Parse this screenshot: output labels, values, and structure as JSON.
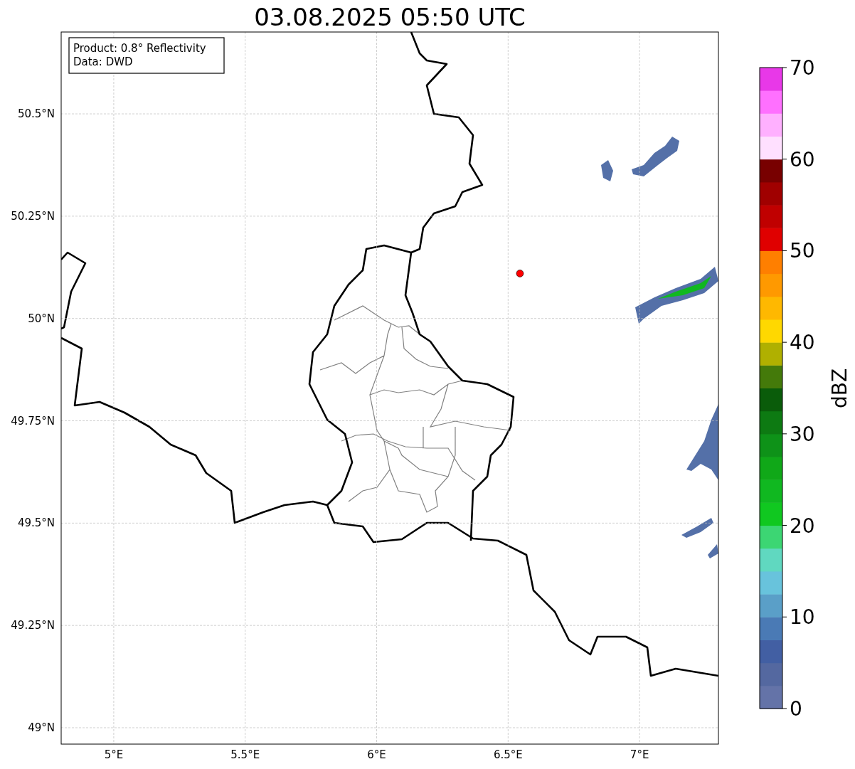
{
  "title": "03.08.2025 05:50 UTC",
  "legend": [
    "Product: 0.8° Reflectivity",
    "Data: DWD"
  ],
  "map": {
    "chart_data": {
      "type": "scatter",
      "x": [
        6.545
      ],
      "series": [
        {
          "color": "#ff0000",
          "values": [
            50.11
          ]
        }
      ],
      "xlim": [
        4.8,
        7.3
      ],
      "grid": true,
      "ylim": [
        48.96,
        50.7
      ],
      "xticks": [
        {
          "value": 5,
          "label": "5°E"
        },
        {
          "value": 5.5,
          "label": "5.5°E"
        },
        {
          "value": 6,
          "label": "6°E"
        },
        {
          "value": 6.5,
          "label": "6.5°E"
        },
        {
          "value": 7,
          "label": "7°E"
        }
      ],
      "yticks": [
        {
          "value": 49,
          "label": "49°N"
        },
        {
          "value": 49.25,
          "label": "49.25°N"
        },
        {
          "value": 49.5,
          "label": "49.5°N"
        },
        {
          "value": 49.75,
          "label": "49.75°N"
        },
        {
          "value": 50,
          "label": "50°N"
        },
        {
          "value": 50.25,
          "label": "50.25°N"
        },
        {
          "value": 50.5,
          "label": "50.5°N"
        }
      ]
    }
  },
  "colorbar": {
    "label": "dBZ",
    "ticks": [
      "70",
      "60",
      "50",
      "40",
      "30",
      "20",
      "10",
      "0"
    ],
    "bins": [
      {
        "color": "#6473a8"
      },
      {
        "color": "#5468a0"
      },
      {
        "color": "#425fa3"
      },
      {
        "color": "#4a7ab5"
      },
      {
        "color": "#5a9fc8"
      },
      {
        "color": "#68c3dc"
      },
      {
        "color": "#60d8c0"
      },
      {
        "color": "#3cd673"
      },
      {
        "color": "#10c820"
      },
      {
        "color": "#10b820"
      },
      {
        "color": "#10a818"
      },
      {
        "color": "#0e9218"
      },
      {
        "color": "#0d7a12"
      },
      {
        "color": "#0a5c0a"
      },
      {
        "color": "#447a0a"
      },
      {
        "color": "#b0b000"
      },
      {
        "color": "#ffd800"
      },
      {
        "color": "#ffb800"
      },
      {
        "color": "#ff9900"
      },
      {
        "color": "#ff7f00"
      },
      {
        "color": "#e00000"
      },
      {
        "color": "#c00000"
      },
      {
        "color": "#a00000"
      },
      {
        "color": "#780000"
      },
      {
        "color": "#ffe0ff"
      },
      {
        "color": "#ffb0ff"
      },
      {
        "color": "#ff70ff"
      },
      {
        "color": "#e838e8"
      }
    ]
  }
}
